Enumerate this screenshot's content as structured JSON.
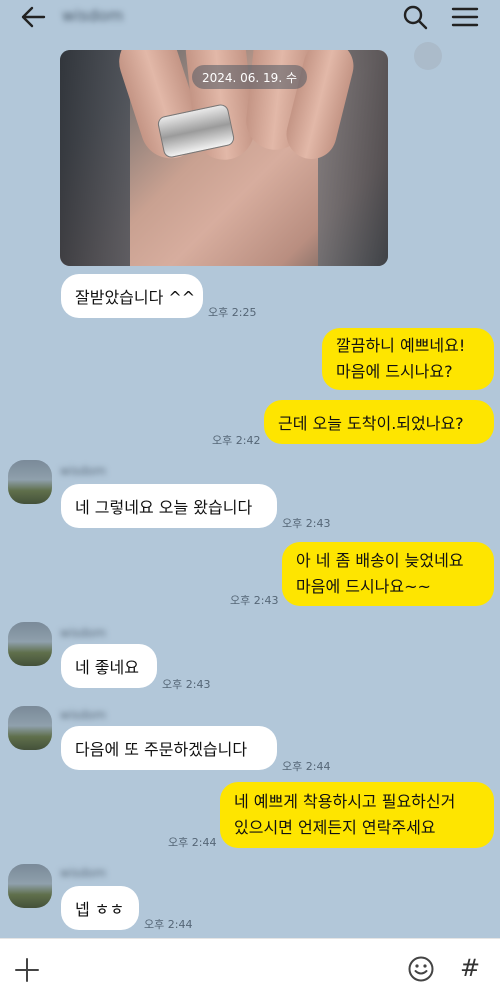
{
  "header": {
    "title": "wisdom",
    "icons": [
      "back-arrow-icon",
      "search-icon",
      "hamburger-menu-icon"
    ]
  },
  "photo": {
    "date_label": "2024. 06. 19. 수"
  },
  "messages": [
    {
      "side": "left",
      "text": "잘받았습니다 ^^",
      "time": "오후 2:25"
    },
    {
      "side": "right",
      "lines": [
        "깔끔하니 예쁘네요!",
        "마음에 드시나요?"
      ]
    },
    {
      "side": "right",
      "text": "근데 오늘 도착이.되었나요?",
      "time": "오후 2:42"
    },
    {
      "side": "left",
      "text": "네 그렇네요 오늘 왔습니다",
      "time": "오후 2:43"
    },
    {
      "side": "right",
      "lines": [
        "아 네 좀 배송이 늦었네요",
        "마음에 드시나요~~"
      ],
      "time": "오후 2:43"
    },
    {
      "side": "left",
      "text": "네 좋네요",
      "time": "오후 2:43"
    },
    {
      "side": "left",
      "text": "다음에 또 주문하겠습니다",
      "time": "오후 2:44"
    },
    {
      "side": "right",
      "lines": [
        "네 예쁘게 착용하시고 필요하신거",
        "있으시면 언제든지 연락주세요"
      ],
      "time": "오후 2:44"
    },
    {
      "side": "left",
      "text": "넵 ㅎㅎ",
      "time": "오후 2:44"
    }
  ],
  "bottom": {
    "hash_symbol": "#"
  },
  "colors": {
    "background": "#b2c7d9",
    "mine": "#fee500",
    "theirs": "#ffffff"
  }
}
